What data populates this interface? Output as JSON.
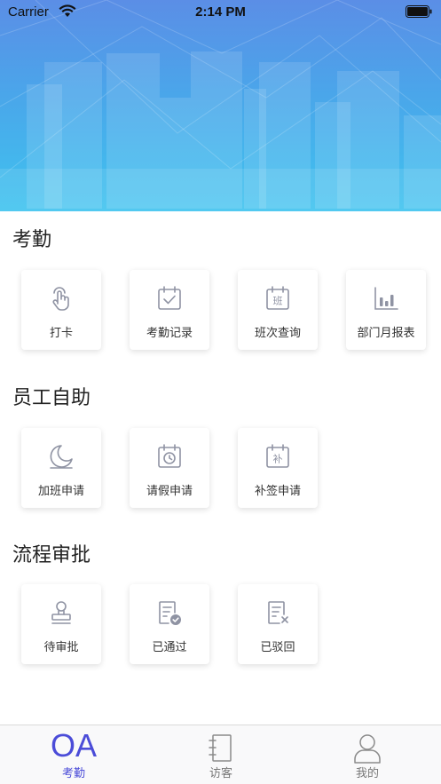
{
  "status_bar": {
    "carrier": "Carrier",
    "time": "2:14 PM"
  },
  "colors": {
    "accent": "#4b4cd8",
    "icon_gray": "#8f93a3",
    "tab_inactive": "#777777"
  },
  "sections": [
    {
      "title": "考勤",
      "items": [
        {
          "label": "打卡",
          "icon": "finger-tap-icon"
        },
        {
          "label": "考勤记录",
          "icon": "calendar-check-icon"
        },
        {
          "label": "班次查询",
          "icon": "calendar-shift-icon"
        },
        {
          "label": "部门月报表",
          "icon": "bar-chart-icon"
        }
      ]
    },
    {
      "title": "员工自助",
      "items": [
        {
          "label": "加班申请",
          "icon": "moon-icon"
        },
        {
          "label": "请假申请",
          "icon": "calendar-clock-icon"
        },
        {
          "label": "补签申请",
          "icon": "calendar-supplement-icon"
        }
      ]
    },
    {
      "title": "流程审批",
      "items": [
        {
          "label": "待审批",
          "icon": "stamp-icon"
        },
        {
          "label": "已通过",
          "icon": "document-approved-icon"
        },
        {
          "label": "已驳回",
          "icon": "document-rejected-icon"
        }
      ]
    }
  ],
  "calendar_glyphs": {
    "shift": "班",
    "supplement": "补"
  },
  "tabbar": [
    {
      "label": "考勤",
      "icon_text": "OA",
      "active": true
    },
    {
      "label": "访客",
      "icon": "notebook-icon",
      "active": false
    },
    {
      "label": "我的",
      "icon": "person-icon",
      "active": false
    }
  ]
}
